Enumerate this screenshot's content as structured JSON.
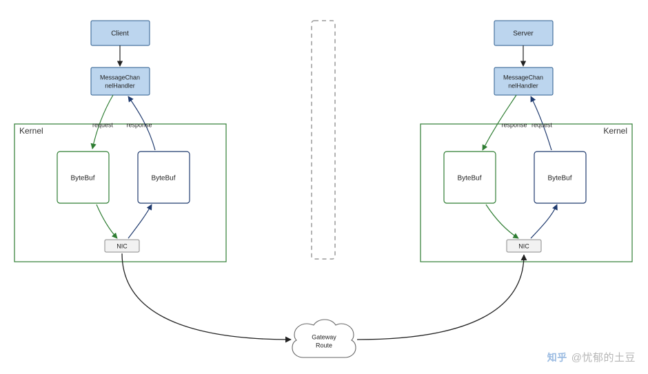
{
  "colors": {
    "blueFill": "#bcd5ee",
    "blueStroke": "#2a5a8c",
    "navy": "#1f3a6e",
    "green": "#2e7d32",
    "greyFill": "#f2f2f2",
    "greyStroke": "#888",
    "black": "#222",
    "dashStroke": "#999"
  },
  "left": {
    "top": "Client",
    "handler_l1": "MessageChan",
    "handler_l2": "nelHandler",
    "kernel": "Kernel",
    "bufLeft": "ByteBuf",
    "bufRight": "ByteBuf",
    "nic": "NIC",
    "arrowLeft": "request",
    "arrowRight": "response"
  },
  "right": {
    "top": "Server",
    "handler_l1": "MessageChan",
    "handler_l2": "nelHandler",
    "kernel": "Kernel",
    "bufLeft": "ByteBuf",
    "bufRight": "ByteBuf",
    "nic": "NIC",
    "arrowLeft": "response",
    "arrowRight": "request"
  },
  "middle": {
    "gateway_l1": "Gateway",
    "gateway_l2": "Route"
  },
  "watermark": {
    "logo": "知乎",
    "text": "@忧郁的土豆"
  }
}
